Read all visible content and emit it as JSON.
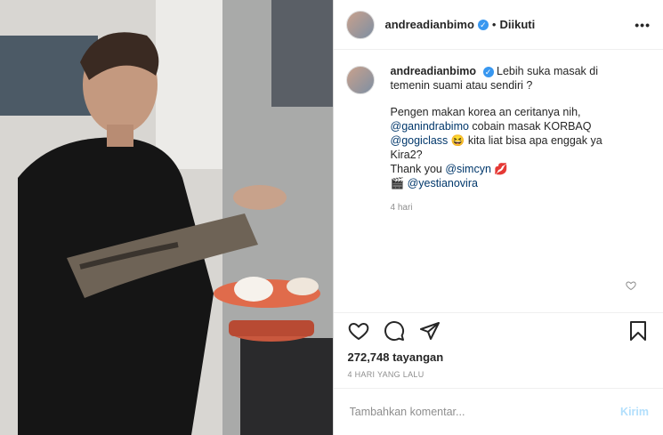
{
  "header": {
    "username": "andreadianbimo",
    "separator": "•",
    "follow_status": "Diikuti",
    "more": "•••"
  },
  "caption": {
    "username": "andreadianbimo",
    "line1": "Lebih suka masak di temenin suami atau sendiri ?",
    "para_pre": "Pengen makan korea an ceritanya nih, ",
    "mention1": "@ganindrabimo",
    "para_mid1": " cobain masak KORBAQ ",
    "mention2": "@gogiclass",
    "emoji1": "😆",
    "para_mid2": " kita liat bisa apa enggak ya Kira2?",
    "thanks": "Thank you ",
    "mention3": "@simcyn",
    "emoji2": "💋",
    "emoji3": "🎬",
    "mention4": "@yestianovira",
    "time": "4 hari"
  },
  "actions": {
    "like": "heart-icon",
    "comment": "comment-icon",
    "share": "share-icon",
    "save": "bookmark-icon"
  },
  "stats": {
    "views": "272,748 tayangan",
    "date": "4 HARI YANG LALU"
  },
  "comment_box": {
    "placeholder": "Tambahkan komentar...",
    "post_label": "Kirim"
  },
  "colors": {
    "verified": "#3897f0",
    "mention": "#00376b",
    "post_disabled": "#b2dffc"
  }
}
